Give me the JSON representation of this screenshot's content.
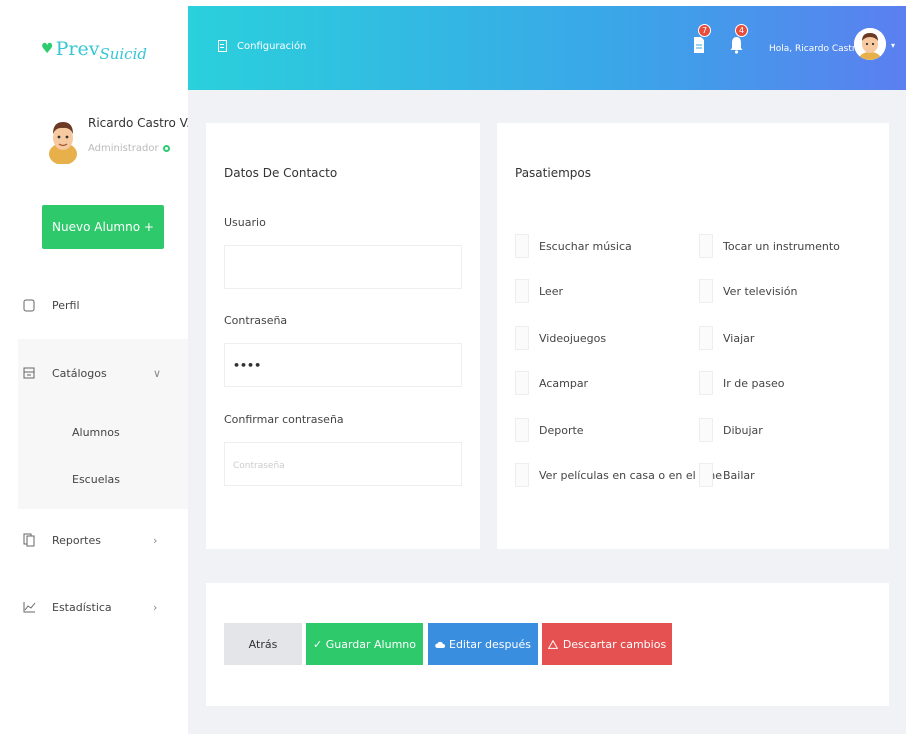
{
  "app": {
    "logo_prefix": "Prev",
    "logo_suffix": "Suicid"
  },
  "sidebar": {
    "user_name": "Ricardo Castro V.",
    "user_role": "Administrador",
    "new_button": "Nuevo Alumno +",
    "items": [
      {
        "label": "Perfil",
        "icon": "user-outline-icon"
      },
      {
        "label": "Catálogos",
        "icon": "catalog-icon",
        "chevron": "∨"
      },
      {
        "label": "Reportes",
        "icon": "copy-icon",
        "chevron": "›"
      },
      {
        "label": "Estadística",
        "icon": "chart-line-icon",
        "chevron": "›"
      }
    ],
    "submenu": [
      "Alumnos",
      "Escuelas"
    ]
  },
  "header": {
    "title": "Configuración",
    "docs_badge": "7",
    "bell_badge": "4",
    "greeting": "Hola, Ricardo Castro V.",
    "caret": "▾"
  },
  "contact": {
    "title": "Datos De Contacto",
    "usuario_label": "Usuario",
    "usuario_value": "",
    "password_label": "Contraseña",
    "password_value": "••••",
    "confirm_label": "Confirmar contraseña",
    "confirm_placeholder": "Contraseña"
  },
  "hobbies": {
    "title": "Pasatiempos",
    "left": [
      "Escuchar música",
      "Leer",
      "Videojuegos",
      "Acampar",
      "Deporte",
      "Ver películas en casa o en el cine"
    ],
    "right": [
      "Tocar un instrumento",
      "Ver televisión",
      "Viajar",
      "Ir de paseo",
      "Dibujar",
      "Bailar"
    ]
  },
  "actions": {
    "back": "Atrás",
    "save": "✓ Guardar Alumno",
    "edit_later": "Editar después",
    "discard": "Descartar cambios"
  },
  "colors": {
    "green": "#2dc96a",
    "blue": "#3a8ee0",
    "red": "#e55050",
    "gray": "#e4e5e9",
    "header_start": "#2ad0dc",
    "header_end": "#5b7ff0"
  }
}
